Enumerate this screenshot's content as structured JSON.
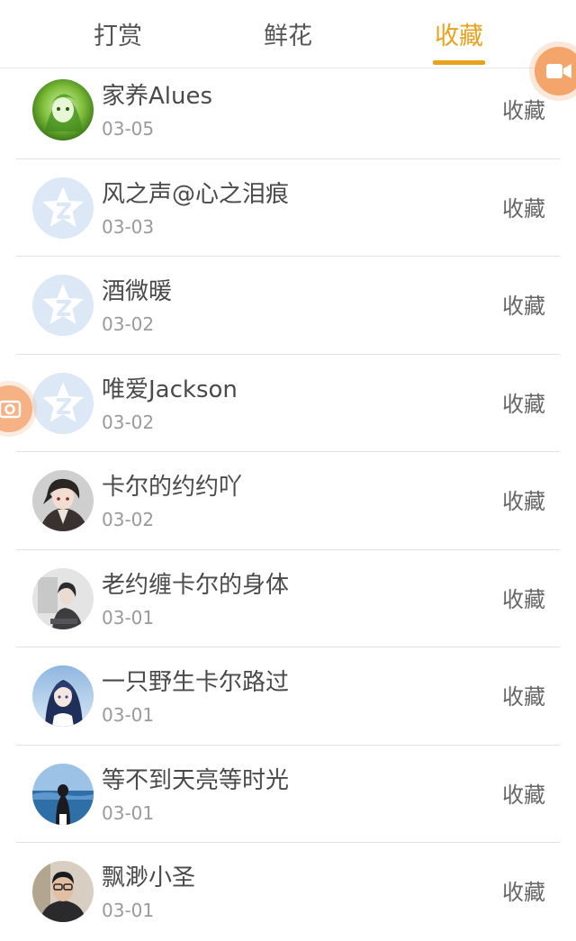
{
  "tabs": [
    {
      "label": "打赏",
      "active": false
    },
    {
      "label": "鲜花",
      "active": false
    },
    {
      "label": "收藏",
      "active": true
    }
  ],
  "colors": {
    "accent": "#e9a21c",
    "float_button": "#f3a56b",
    "default_avatar": "#dce8f6"
  },
  "items": [
    {
      "name": "家养Alues",
      "date": "03-05",
      "action": "收藏",
      "avatar": "green-anime-avatar"
    },
    {
      "name": "风之声@心之泪痕",
      "date": "03-03",
      "action": "收藏",
      "avatar": "qzone-default-avatar"
    },
    {
      "name": "酒微暖",
      "date": "03-02",
      "action": "收藏",
      "avatar": "qzone-default-avatar"
    },
    {
      "name": "唯爱Jackson",
      "date": "03-02",
      "action": "收藏",
      "avatar": "qzone-default-avatar"
    },
    {
      "name": "卡尔的约约吖",
      "date": "03-02",
      "action": "收藏",
      "avatar": "anime-boy-avatar"
    },
    {
      "name": "老约缠卡尔的身体",
      "date": "03-01",
      "action": "收藏",
      "avatar": "sitting-figure-avatar"
    },
    {
      "name": "一只野生卡尔路过",
      "date": "03-01",
      "action": "收藏",
      "avatar": "anime-girl-avatar"
    },
    {
      "name": "等不到天亮等时光",
      "date": "03-01",
      "action": "收藏",
      "avatar": "ocean-girl-avatar"
    },
    {
      "name": "飘渺小圣",
      "date": "03-01",
      "action": "收藏",
      "avatar": "man-photo-avatar"
    }
  ],
  "floating": {
    "video_icon": "video-camera-icon",
    "camera_icon": "camera-icon"
  }
}
